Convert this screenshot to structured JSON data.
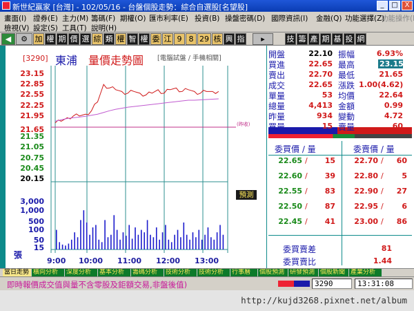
{
  "window": {
    "title": "新世紀贏家 [台灣] - 102/05/16 - 台盤個股走勢：綜合自選股[名望股]",
    "buttons": [
      "_",
      "□",
      "X"
    ]
  },
  "menu": {
    "row1": [
      "畫面(I)",
      "證券(E)",
      "主力(M)",
      "籌碼(F)",
      "期權(O)",
      "匯市利率(E)",
      "投資(B)",
      "操盤密碼(D)",
      "國際資訊(I)",
      "金融(Q)",
      "功能選擇(Z)",
      "功能操作(R)"
    ],
    "row2": [
      "檢視(V)",
      "設定(S)",
      "工具(T)",
      "說明(H)"
    ]
  },
  "toolbar": {
    "buttons": [
      "加",
      "權",
      "期",
      "價",
      "選",
      "綜",
      "類",
      "權",
      "智",
      "權",
      "委",
      "江",
      "9",
      "8",
      "29",
      "核",
      "興",
      "指",
      "技",
      "籌",
      "產",
      "期",
      "基",
      "投",
      "網"
    ]
  },
  "chart": {
    "code": "[3290]",
    "stock_name": "東浦",
    "title": "量價走勢圖",
    "subtitle": "[電腦試盤 / 手機相關]",
    "prediction_label": "預測",
    "ref_label": "(昨收)",
    "vol_unit_label": "張",
    "price_ticks": [
      "23.15",
      "22.85",
      "22.55",
      "22.25",
      "21.95",
      "21.65",
      "21.35",
      "21.05",
      "20.75",
      "20.45",
      "20.15"
    ],
    "volume_ticks": [
      "3,000",
      "1,000",
      "500",
      "100",
      "50",
      "15"
    ],
    "time_ticks": [
      "9:00",
      "10:00",
      "11:00",
      "12:00",
      "13:00"
    ]
  },
  "chart_data": {
    "type": "line",
    "x": [
      "9:00",
      "9:10",
      "9:20",
      "9:30",
      "9:40",
      "9:50",
      "10:00",
      "10:10",
      "10:20",
      "10:30",
      "10:40",
      "10:50",
      "11:00",
      "11:10",
      "11:20",
      "11:30",
      "11:40",
      "11:50",
      "12:00",
      "12:10",
      "12:20",
      "12:30",
      "12:40",
      "12:50",
      "13:00",
      "13:10",
      "13:20",
      "13:30"
    ],
    "series": [
      {
        "values": [
          21.75,
          21.8,
          21.9,
          21.95,
          21.95,
          22.0,
          22.1,
          22.35,
          22.85,
          22.75,
          22.7,
          22.65,
          22.6,
          22.65,
          22.6,
          22.55,
          22.6,
          22.7,
          22.6,
          22.7,
          22.75,
          22.65,
          22.7,
          22.65,
          22.6,
          22.65,
          22.65,
          22.65
        ]
      },
      {
        "values": [
          21.8,
          21.84,
          21.88,
          21.9,
          21.92,
          21.94,
          21.97,
          22.0,
          22.05,
          22.1,
          22.14,
          22.17,
          22.2,
          22.22,
          22.24,
          22.26,
          22.28,
          22.3,
          22.32,
          22.34,
          22.36,
          22.38,
          22.4,
          22.4,
          22.41,
          22.42,
          22.43,
          22.44
        ]
      }
    ],
    "ylim": [
      20.15,
      23.15
    ],
    "reference": 21.65
  },
  "volume_data": {
    "values": [
      40,
      15,
      10,
      8,
      12,
      20,
      35,
      25,
      60,
      80,
      55,
      30,
      45,
      50,
      20,
      15,
      60,
      25,
      30,
      70,
      40,
      20,
      35,
      28,
      50,
      22,
      45,
      30,
      40,
      35,
      60,
      30,
      25,
      45,
      20,
      35,
      50,
      20,
      15,
      30,
      40,
      25,
      55,
      30,
      20,
      35,
      25,
      40,
      20,
      30,
      45,
      25,
      20,
      35,
      50,
      30
    ]
  },
  "quote": {
    "rows": [
      {
        "l1": "開盤",
        "v1": "22.10",
        "c1": "black",
        "l2": "振幅",
        "v2": "6.93%",
        "c2": "red"
      },
      {
        "l1": "買進",
        "v1": "22.65",
        "c1": "red",
        "l2": "最高",
        "v2": "23.15",
        "c2": "hl"
      },
      {
        "l1": "賣出",
        "v1": "22.70",
        "c1": "red",
        "l2": "最低",
        "v2": "21.65",
        "c2": "red"
      },
      {
        "l1": "成交",
        "v1": "22.65",
        "c1": "red",
        "l2": "漲跌",
        "v2": "1.00(4.62)",
        "c2": "red"
      },
      {
        "l1": "單量",
        "v1": "53",
        "c1": "red",
        "l2": "均價",
        "v2": "22.64",
        "c2": "red"
      },
      {
        "l1": "總量",
        "v1": "4,413",
        "c1": "red",
        "l2": "金額",
        "v2": "0.99",
        "c2": "red"
      },
      {
        "l1": "昨量",
        "v1": "934",
        "c1": "red",
        "l2": "變動",
        "v2": "4.72",
        "c2": "red"
      },
      {
        "l1": "買量",
        "v1": "15",
        "c1": "red",
        "l2": "賣量",
        "v2": "60",
        "c2": "red"
      }
    ]
  },
  "orderbook": {
    "bid_header": "委買價 / 量",
    "ask_header": "委賣價 / 量",
    "bids": [
      {
        "price": "22.65",
        "qty": "15"
      },
      {
        "price": "22.60",
        "qty": "39"
      },
      {
        "price": "22.55",
        "qty": "83"
      },
      {
        "price": "22.50",
        "qty": "87"
      },
      {
        "price": "22.45",
        "qty": "41"
      }
    ],
    "asks": [
      {
        "price": "22.70",
        "qty": "60"
      },
      {
        "price": "22.80",
        "qty": "5"
      },
      {
        "price": "22.90",
        "qty": "27"
      },
      {
        "price": "22.95",
        "qty": "6"
      },
      {
        "price": "23.00",
        "qty": "86"
      }
    ],
    "diff_label": "委買賣差",
    "diff_value": "81",
    "ratio_label": "委買賣比",
    "ratio_value": "1.44"
  },
  "tabs": [
    "當日走勢",
    "橫向分析",
    "深度分析",
    "基本分析",
    "籌碼分析",
    "技術分析",
    "技術分析",
    "行事曆",
    "個股預測",
    "研發預測",
    "個股新聞",
    "產業分析"
  ],
  "status": {
    "message": "即時報價成交值與量不含零股及鉅額交易,非盤後值)",
    "code": "3290",
    "time": "13:31:08"
  },
  "watermark": {
    "url": "http://kujd3268.pixnet.net/album"
  }
}
